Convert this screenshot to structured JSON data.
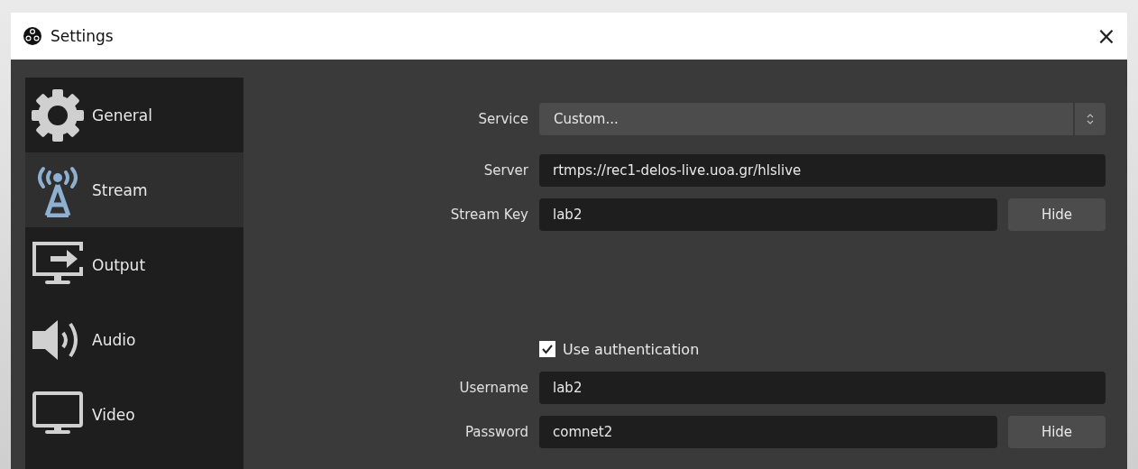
{
  "window": {
    "title": "Settings",
    "close": "×"
  },
  "sidebar": {
    "items": [
      {
        "label": "General",
        "kind": "gear",
        "selected": false
      },
      {
        "label": "Stream",
        "kind": "antenna",
        "selected": true
      },
      {
        "label": "Output",
        "kind": "monitor-arrow",
        "selected": false
      },
      {
        "label": "Audio",
        "kind": "speaker",
        "selected": false
      },
      {
        "label": "Video",
        "kind": "monitor",
        "selected": false
      }
    ]
  },
  "form": {
    "rows": [
      {
        "kind": "select",
        "label": "Service",
        "value": "Custom..."
      },
      {
        "kind": "text",
        "label": "Server",
        "value": "rtmps://rec1-delos-live.uoa.gr/hlslive"
      },
      {
        "kind": "secret",
        "label": "Stream Key",
        "value": "lab2",
        "button": "Hide"
      },
      {
        "kind": "spacer"
      },
      {
        "kind": "checkbox",
        "label": "Use authentication",
        "checked": true
      },
      {
        "kind": "text",
        "label": "Username",
        "value": "lab2"
      },
      {
        "kind": "secret",
        "label": "Password",
        "value": "comnet2",
        "button": "Hide"
      }
    ]
  }
}
